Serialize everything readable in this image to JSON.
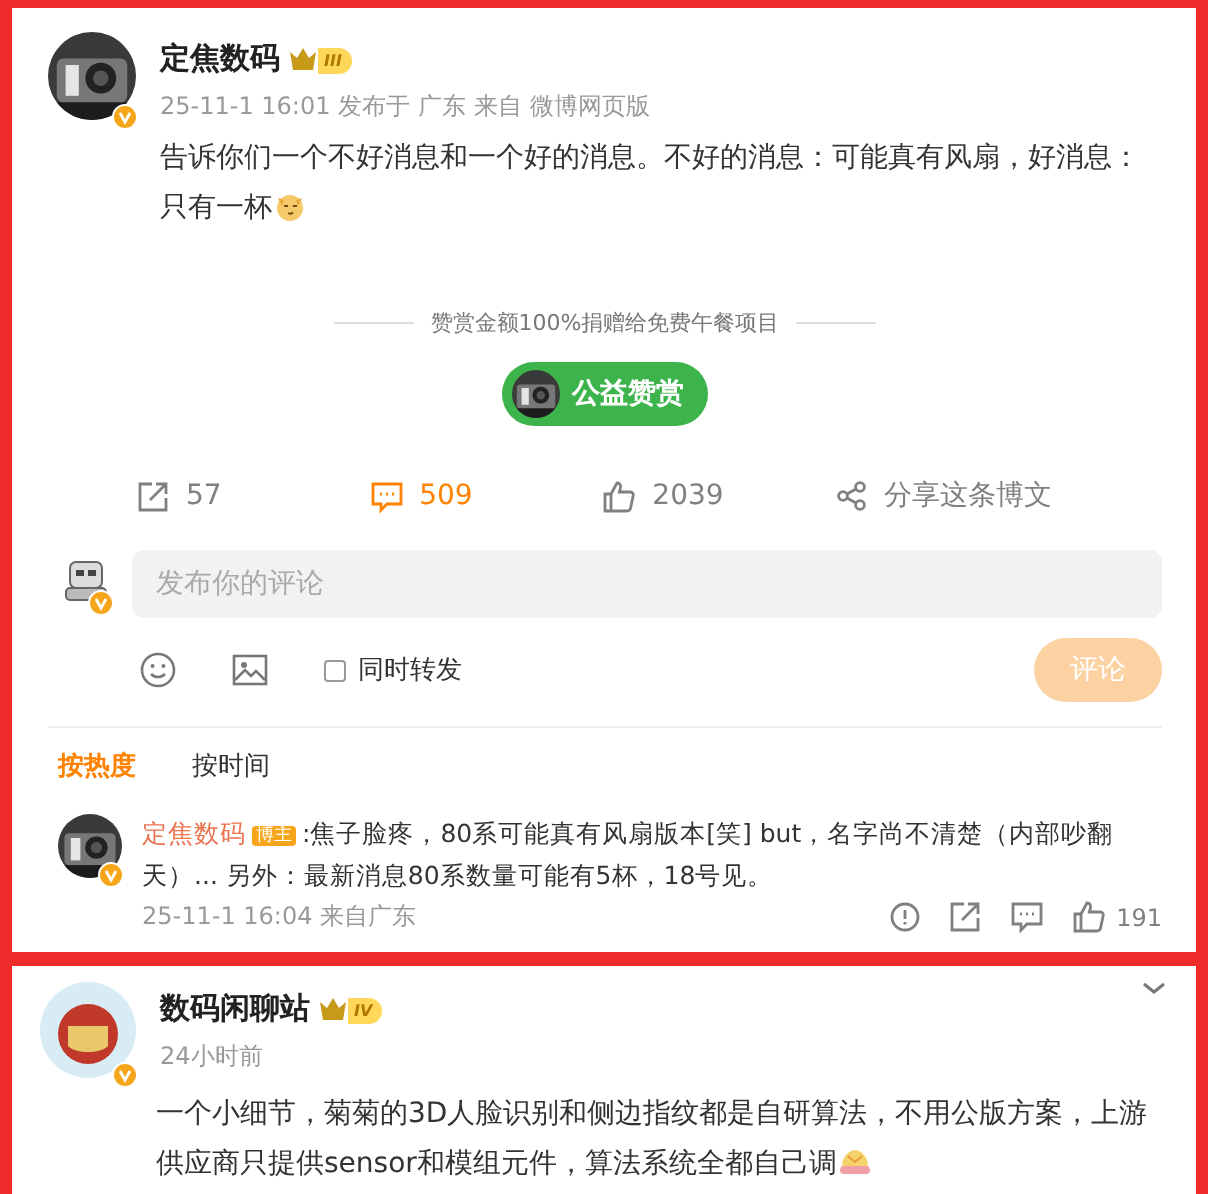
{
  "post": {
    "author": "定焦数码",
    "level": "III",
    "time": "25-11-1 16:01",
    "location": "发布于 广东",
    "source": "来自 微博网页版",
    "text": "告诉你们一个不好消息和一个好的消息。不好的消息：可能真有风扇，好消息：只有一杯"
  },
  "donation": {
    "note": "赞赏金额100%捐赠给免费午餐项目",
    "button": "公益赞赏"
  },
  "actions": [
    {
      "kind": "repost",
      "count": "57",
      "selected": false
    },
    {
      "kind": "comment",
      "count": "509",
      "selected": true
    },
    {
      "kind": "like",
      "count": "2039",
      "selected": false
    },
    {
      "kind": "share",
      "count": "分享这条博文",
      "selected": false
    }
  ],
  "composer": {
    "placeholder": "发布你的评论",
    "repost_option": {
      "label": "同时转发",
      "checked": false
    },
    "submit": {
      "label": "评论",
      "disabled": true
    }
  },
  "sort_tabs": [
    {
      "label": "按热度",
      "selected": true
    },
    {
      "label": "按时间",
      "selected": false
    }
  ],
  "comments": [
    {
      "author": "定焦数码",
      "badge": "博主",
      "text": ":焦子脸疼，80系可能真有风扇版本[笑] but，名字尚不清楚（内部吵翻天）... 另外：最新消息80系数量可能有5杯，18号见。",
      "time": "25-11-1 16:04",
      "source": "来自广东",
      "likes": "191"
    }
  ],
  "next_post": {
    "author": "数码闲聊站",
    "level": "IV",
    "time": "24小时前",
    "text": "一个小细节，菊菊的3D人脸识别和侧边指纹都是自研算法，不用公版方案，上游供应商只提供sensor和模组元件，算法系统全都自己调"
  }
}
